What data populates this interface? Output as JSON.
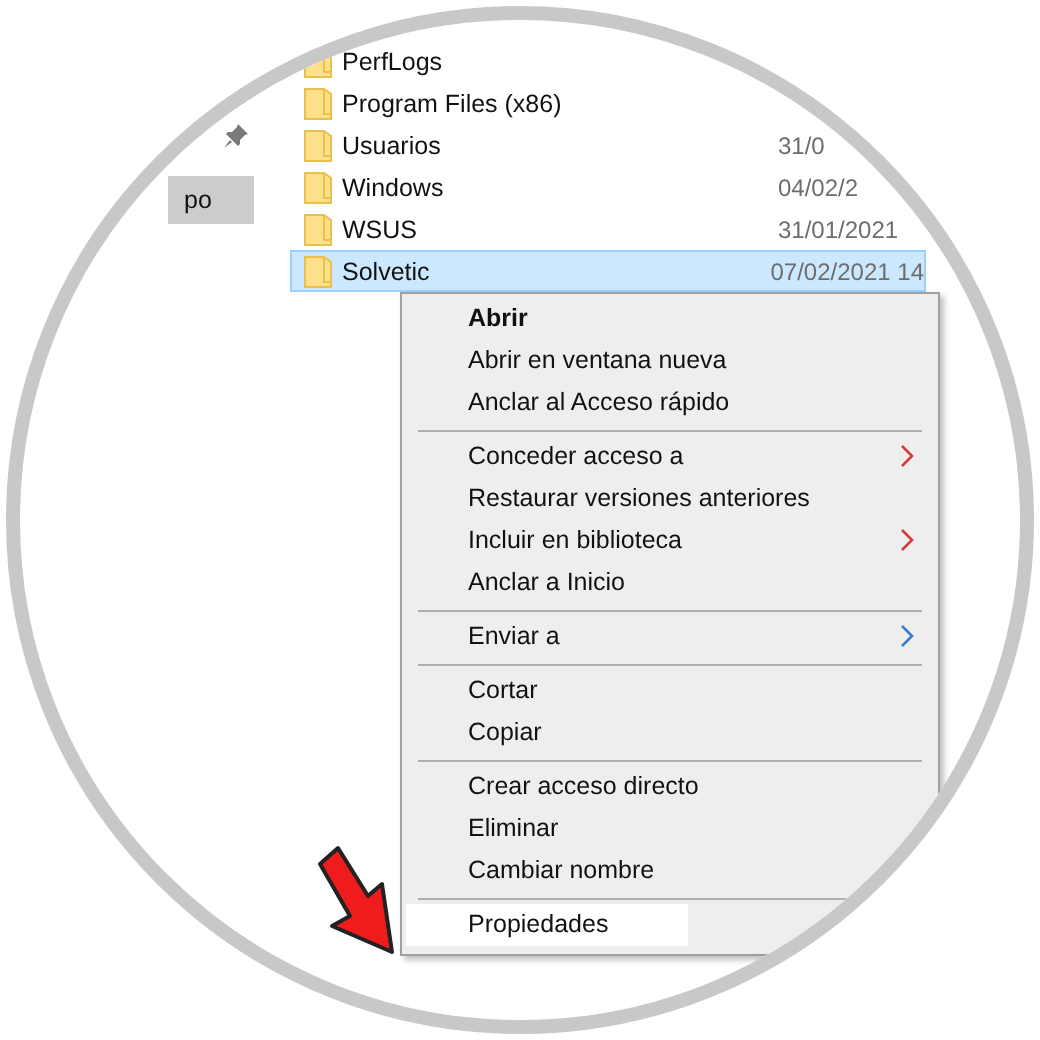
{
  "sidebar": {
    "items": [
      {
        "label": "po",
        "selected": true
      }
    ]
  },
  "files": [
    {
      "name": "PerfLogs",
      "selected": false
    },
    {
      "name": "Program Files (x86)",
      "selected": false
    },
    {
      "name": "Usuarios",
      "date": "31/0",
      "selected": false
    },
    {
      "name": "Windows",
      "date": "04/02/2",
      "selected": false
    },
    {
      "name": "WSUS",
      "date": "31/01/2021",
      "selected": false
    },
    {
      "name": "Solvetic",
      "date": "07/02/2021 14",
      "selected": true
    }
  ],
  "context_menu": {
    "sections": [
      [
        {
          "label": "Abrir",
          "kind": "default",
          "selected": false
        },
        {
          "label": "Abrir en ventana nueva",
          "kind": "command",
          "selected": false
        },
        {
          "label": "Anclar al Acceso rápido",
          "kind": "command",
          "selected": false
        }
      ],
      [
        {
          "label": "Conceder acceso a",
          "kind": "submenu",
          "color": "#d9383a",
          "selected": false
        },
        {
          "label": "Restaurar versiones anteriores",
          "kind": "command",
          "selected": false
        },
        {
          "label": "Incluir en biblioteca",
          "kind": "submenu",
          "color": "#d9383a",
          "selected": false
        },
        {
          "label": "Anclar a Inicio",
          "kind": "command",
          "selected": false
        }
      ],
      [
        {
          "label": "Enviar a",
          "kind": "submenu",
          "color": "#3a7bd5",
          "selected": false
        }
      ],
      [
        {
          "label": "Cortar",
          "kind": "command",
          "selected": false
        },
        {
          "label": "Copiar",
          "kind": "command",
          "selected": false
        }
      ],
      [
        {
          "label": "Crear acceso directo",
          "kind": "command",
          "selected": false
        },
        {
          "label": "Eliminar",
          "kind": "command",
          "selected": false
        },
        {
          "label": "Cambiar nombre",
          "kind": "command",
          "selected": false
        }
      ],
      [
        {
          "label": "Propiedades",
          "kind": "command",
          "selected": true
        }
      ]
    ]
  }
}
